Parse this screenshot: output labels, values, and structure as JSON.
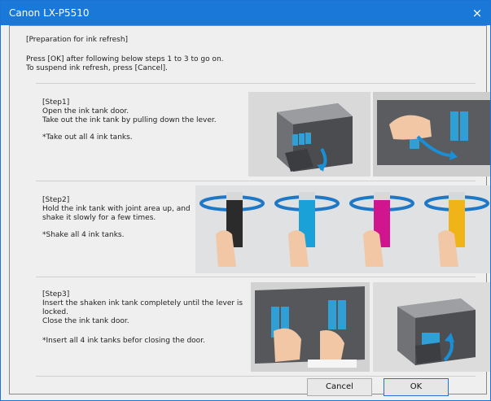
{
  "window": {
    "title": "Canon LX-P5510",
    "close_glyph": "×"
  },
  "intro": {
    "heading": "[Preparation for ink refresh]",
    "line1": "Press [OK] after following below steps 1 to 3 to go on.",
    "line2": "To suspend ink refresh, press [Cancel]."
  },
  "steps": [
    {
      "title": "[Step1]",
      "lines": [
        "Open the ink tank door.",
        "Take out the ink tank by pulling down the lever."
      ],
      "note": "*Take out all 4 ink tanks."
    },
    {
      "title": "[Step2]",
      "lines": [
        "Hold the ink tank with joint area up, and",
        "shake it slowly for a few times."
      ],
      "note": "*Shake all 4 ink tanks."
    },
    {
      "title": "[Step3]",
      "lines": [
        "Insert the shaken ink tank completely until the lever is",
        "locked.",
        "Close the ink tank door."
      ],
      "note": "*Insert all 4 ink tanks befor closing the door."
    }
  ],
  "buttons": {
    "cancel": "Cancel",
    "ok": "OK"
  },
  "ink_colors": [
    "#2b2b2b",
    "#1aa2d8",
    "#d1158e",
    "#f0b318"
  ],
  "accent_color": "#1a79d8"
}
